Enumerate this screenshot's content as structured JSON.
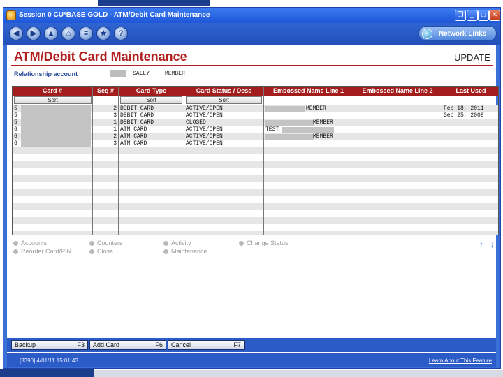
{
  "window": {
    "title": "Session 0 CU*BASE GOLD - ATM/Debit Card Maintenance",
    "minimize": "_",
    "maximize": "□",
    "close": "✕",
    "restore": "❐"
  },
  "toolbar": {
    "back": "◀",
    "forward": "▶",
    "up": "▲",
    "home": "⌂",
    "list": "≡",
    "fav": "★",
    "help": "?",
    "network_links": "Network Links"
  },
  "page": {
    "title": "ATM/Debit Card Maintenance",
    "mode": "UPDATE",
    "relationship_label": "Relationship account",
    "relationship_first": "SALLY",
    "relationship_last": "MEMBER"
  },
  "table": {
    "headers": [
      "Card #",
      "Seq #",
      "Card Type",
      "Card Status / Desc",
      "Embossed Name Line 1",
      "Embossed Name Line 2",
      "Last Used"
    ],
    "sort_label": "Sort",
    "rows": [
      {
        "card": "5",
        "seq": "2",
        "type": "DEBIT CARD",
        "status": "ACTIVE/OPEN",
        "name1": "MEMBER",
        "name2": "",
        "last": "Feb 18, 2011"
      },
      {
        "card": "5",
        "seq": "3",
        "type": "DEBIT CARD",
        "status": "ACTIVE/OPEN",
        "name1": "",
        "name2": "",
        "last": "Sep 25, 2009"
      },
      {
        "card": "5",
        "seq": "1",
        "type": "DEBIT CARD",
        "status": "CLOSED",
        "name1": "MEMBER",
        "name2": "",
        "last": ""
      },
      {
        "card": "6",
        "seq": "1",
        "type": "ATM CARD",
        "status": "ACTIVE/OPEN",
        "name1": "TEST",
        "name2": "",
        "last": ""
      },
      {
        "card": "6",
        "seq": "2",
        "type": "ATM CARD",
        "status": "ACTIVE/OPEN",
        "name1": "MEMBER",
        "name2": "",
        "last": ""
      },
      {
        "card": "6",
        "seq": "3",
        "type": "ATM CARD",
        "status": "ACTIVE/OPEN",
        "name1": "",
        "name2": "",
        "last": ""
      }
    ]
  },
  "options": [
    "Accounts",
    "Counters",
    "Activity",
    "Change Status",
    "Reorder Card/PIN",
    "Close",
    "Maintenance"
  ],
  "arrows": {
    "up": "↑",
    "down": "↓"
  },
  "fkeys": [
    {
      "label": "Backup",
      "key": "F3"
    },
    {
      "label": "Add Card",
      "key": "F6"
    },
    {
      "label": "Cancel",
      "key": "F7"
    }
  ],
  "status": {
    "left": "[3390] 4/01/11 15:01:43",
    "learn": "Learn About This Feature"
  }
}
